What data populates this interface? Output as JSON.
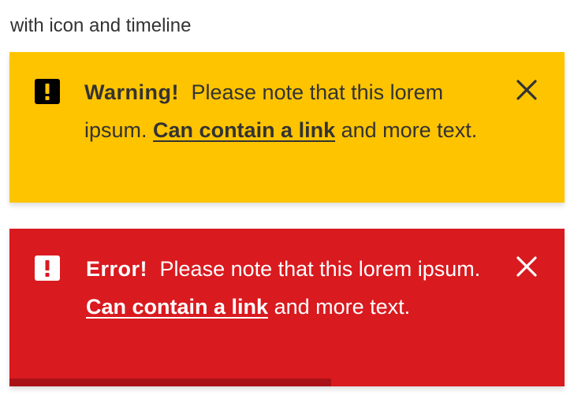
{
  "caption": "with icon and timeline",
  "colors": {
    "warning_bg": "#ffc400",
    "error_bg": "#d91a1f",
    "timeline": "#a91318",
    "text_dark": "#333333",
    "text_light": "#ffffff"
  },
  "alerts": [
    {
      "type": "warning",
      "icon": "exclamation-square-icon",
      "title": "Warning!",
      "text_before": "Please note that this lorem ipsum.",
      "link": "Can contain a link",
      "text_after": "and more text.",
      "close_icon": "close-icon"
    },
    {
      "type": "error",
      "icon": "exclamation-square-icon",
      "title": "Error!",
      "text_before": "Please note that this lorem ipsum.",
      "link": "Can contain a link",
      "text_after": "and more text.",
      "close_icon": "close-icon",
      "timeline_progress": 0.58
    }
  ]
}
